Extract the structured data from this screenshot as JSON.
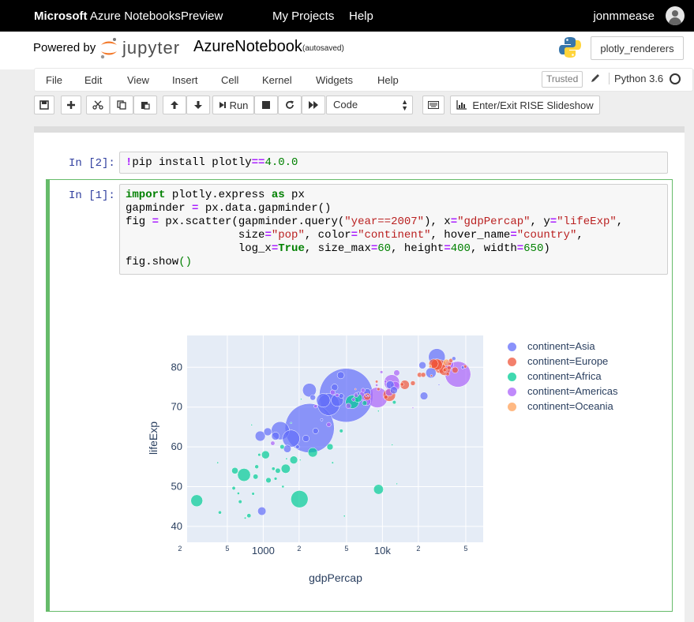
{
  "azure_bar": {
    "brand_bold": "Microsoft",
    "brand_rest": " Azure Notebooks",
    "preview": "Preview",
    "my_projects": "My Projects",
    "help": "Help",
    "user": "jonmmease"
  },
  "header": {
    "powered_by": "Powered by",
    "jupyter_word": "jupyter",
    "notebook_name": "AzureNotebook",
    "save_status": "(autosaved)",
    "kernel_button": "plotly_renderers"
  },
  "menubar": {
    "items": [
      "File",
      "Edit",
      "View",
      "Insert",
      "Cell",
      "Kernel",
      "Widgets",
      "Help"
    ],
    "trusted": "Trusted",
    "kernel": "Python 3.6"
  },
  "toolbar": {
    "run": "Run",
    "cell_type": "Code",
    "rise": "Enter/Exit RISE Slideshow"
  },
  "cells": [
    {
      "prompt": "In [2]:",
      "code_parts": [
        [
          "bang",
          "!"
        ],
        [
          "plain",
          "pip install plotly"
        ],
        [
          "op",
          "=="
        ],
        [
          "num",
          "4.0.0"
        ]
      ]
    },
    {
      "prompt": "In [1]:",
      "lines": [
        [
          [
            "kw",
            "import"
          ],
          [
            "plain",
            " plotly.express "
          ],
          [
            "kw",
            "as"
          ],
          [
            "plain",
            " px"
          ]
        ],
        [
          [
            "plain",
            "gapminder "
          ],
          [
            "op",
            "="
          ],
          [
            "plain",
            " px.data.gapminder()"
          ]
        ],
        [
          [
            "plain",
            "fig "
          ],
          [
            "op",
            "="
          ],
          [
            "plain",
            " px.scatter(gapminder.query("
          ],
          [
            "str",
            "\"year==2007\""
          ],
          [
            "plain",
            "), x"
          ],
          [
            "op",
            "="
          ],
          [
            "str",
            "\"gdpPercap\""
          ],
          [
            "plain",
            ", y"
          ],
          [
            "op",
            "="
          ],
          [
            "str",
            "\"lifeExp\""
          ],
          [
            "plain",
            ","
          ]
        ],
        [
          [
            "plain",
            "                 size"
          ],
          [
            "op",
            "="
          ],
          [
            "str",
            "\"pop\""
          ],
          [
            "plain",
            ", color"
          ],
          [
            "op",
            "="
          ],
          [
            "str",
            "\"continent\""
          ],
          [
            "plain",
            ", hover_name"
          ],
          [
            "op",
            "="
          ],
          [
            "str",
            "\"country\""
          ],
          [
            "plain",
            ","
          ]
        ],
        [
          [
            "plain",
            "                 log_x"
          ],
          [
            "op",
            "="
          ],
          [
            "kw",
            "True"
          ],
          [
            "plain",
            ", size_max"
          ],
          [
            "op",
            "="
          ],
          [
            "num",
            "60"
          ],
          [
            "plain",
            ", height"
          ],
          [
            "op",
            "="
          ],
          [
            "num",
            "400"
          ],
          [
            "plain",
            ", width"
          ],
          [
            "op",
            "="
          ],
          [
            "num",
            "650"
          ],
          [
            "plain",
            ")"
          ]
        ],
        [
          [
            "plain",
            "fig.show"
          ],
          [
            "num",
            "()"
          ]
        ]
      ]
    }
  ],
  "chart_data": {
    "type": "scatter",
    "xlabel": "gdpPercap",
    "ylabel": "lifeExp",
    "x_scale": "log",
    "xlim": [
      230,
      70000
    ],
    "ylim": [
      36,
      88
    ],
    "x_ticks": [
      {
        "value": 200,
        "label": "2"
      },
      {
        "value": 500,
        "label": "5"
      },
      {
        "value": 1000,
        "label": "1000"
      },
      {
        "value": 2000,
        "label": "2"
      },
      {
        "value": 5000,
        "label": "5"
      },
      {
        "value": 10000,
        "label": "10k"
      },
      {
        "value": 20000,
        "label": "2"
      },
      {
        "value": 50000,
        "label": "5"
      }
    ],
    "y_ticks": [
      40,
      50,
      60,
      70,
      80
    ],
    "grid": true,
    "legend_position": "right",
    "series": [
      {
        "name": "continent=Asia",
        "color": "#636efa",
        "points": [
          [
            4959,
            72.96,
            1318683096
          ],
          [
            2452,
            64.7,
            1110396331
          ],
          [
            3541,
            70.65,
            223547000
          ],
          [
            1391,
            64.06,
            150448339
          ],
          [
            28604,
            82.6,
            127467972
          ],
          [
            1713,
            62.07,
            135031164
          ],
          [
            3190,
            71.69,
            85262356
          ],
          [
            2442,
            74.25,
            85262356
          ],
          [
            1091,
            63.79,
            28901790
          ],
          [
            974,
            43.83,
            31889923
          ],
          [
            7458,
            73.75,
            22276056
          ],
          [
            4471,
            78.0,
            23174294
          ],
          [
            12452,
            74.24,
            24821286
          ],
          [
            21655,
            80.5,
            23301725
          ],
          [
            47143,
            79.97,
            4553009
          ],
          [
            39725,
            82.2,
            6980412
          ],
          [
            944,
            62.7,
            47761980
          ],
          [
            1593,
            59.5,
            26000000
          ],
          [
            2282,
            62.1,
            19951656
          ],
          [
            3970,
            74.95,
            20378239
          ],
          [
            4185,
            71.7,
            69453570
          ],
          [
            22316,
            72.8,
            27601038
          ],
          [
            11606,
            75.6,
            28901790
          ],
          [
            2605,
            72.4,
            14131858
          ],
          [
            1940,
            60.0,
            6500000
          ],
          [
            3095,
            66.8,
            2874127
          ],
          [
            6290,
            73.4,
            4100000
          ],
          [
            4519,
            72.8,
            10300000
          ],
          [
            25523,
            78.6,
            49044790
          ],
          [
            29796,
            75.6,
            708573
          ],
          [
            1268,
            62.7,
            29000000
          ],
          [
            2749,
            64.0,
            15000000
          ]
        ]
      },
      {
        "name": "continent=Europe",
        "color": "#ef553b",
        "points": [
          [
            30470,
            80.2,
            82400996
          ],
          [
            28569,
            80.7,
            58147733
          ],
          [
            33203,
            79.4,
            60776238
          ],
          [
            28570,
            80.5,
            61083916
          ],
          [
            26865,
            80.9,
            40448191
          ],
          [
            15390,
            75.6,
            38518241
          ],
          [
            7457,
            72.6,
            22276056
          ],
          [
            11416,
            73.0,
            71158647
          ],
          [
            36180,
            79.8,
            8199783
          ],
          [
            33692,
            79.4,
            10392226
          ],
          [
            40676,
            79.3,
            16570613
          ],
          [
            22000,
            78.1,
            10642836
          ],
          [
            18009,
            76.0,
            10228744
          ],
          [
            20510,
            78.1,
            10706290
          ],
          [
            37506,
            81.7,
            7554661
          ],
          [
            10680,
            72.5,
            7322858
          ],
          [
            9253,
            74.5,
            4552198
          ],
          [
            25768,
            77.9,
            2009245
          ],
          [
            14619,
            75.7,
            5447502
          ],
          [
            36319,
            80.9,
            9031088
          ],
          [
            35278,
            78.3,
            5468120
          ],
          [
            33207,
            79.3,
            5238460
          ],
          [
            49357,
            80.2,
            4627926
          ],
          [
            36811,
            80.9,
            4109086
          ],
          [
            8948,
            76.4,
            3600523
          ],
          [
            5937,
            74.5,
            1300000
          ]
        ]
      },
      {
        "name": "continent=Africa",
        "color": "#00cc96",
        "points": [
          [
            2014,
            46.86,
            135031164
          ],
          [
            690,
            52.95,
            76511887
          ],
          [
            1803,
            56.7,
            28000000
          ],
          [
            5581,
            71.3,
            80264543
          ],
          [
            9270,
            49.3,
            43997828
          ],
          [
            6223,
            72.3,
            33333216
          ],
          [
            2603,
            58.6,
            40448191
          ],
          [
            277,
            46.46,
            64606759
          ],
          [
            1046,
            58.0,
            29170398
          ],
          [
            1544,
            54.5,
            38139640
          ],
          [
            3632,
            60.0,
            18000000
          ],
          [
            1327,
            54.0,
            12000000
          ],
          [
            7093,
            71.0,
            10276158
          ],
          [
            4513,
            64.0,
            6036914
          ],
          [
            9253,
            69.0,
            1300000
          ],
          [
            12570,
            71.2,
            6036914
          ],
          [
            863,
            52.5,
            12000000
          ],
          [
            579,
            54.0,
            19000000
          ],
          [
            1107,
            51.6,
            13000000
          ],
          [
            759,
            42.7,
            8000000
          ],
          [
            1441,
            60.0,
            9000000
          ],
          [
            882,
            55.0,
            7000000
          ],
          [
            641,
            46.2,
            6000000
          ],
          [
            433,
            43.5,
            5000000
          ],
          [
            926,
            58.0,
            4000000
          ],
          [
            1463,
            50.0,
            3000000
          ],
          [
            706,
            42.1,
            2000000
          ],
          [
            13206,
            50.7,
            1000000
          ],
          [
            4797,
            42.6,
            1500000
          ],
          [
            1569,
            57.0,
            1600000
          ],
          [
            619,
            48.3,
            3100000
          ],
          [
            823,
            48.2,
            3900000
          ],
          [
            1217,
            54.5,
            5300000
          ],
          [
            415,
            56.0,
            1500000
          ],
          [
            1712,
            66.0,
            700000
          ],
          [
            2082,
            72.0,
            500000
          ],
          [
            1270,
            52.0,
            4400000
          ],
          [
            566,
            49.6,
            5600000
          ],
          [
            12057,
            60.5,
            800000
          ],
          [
            3820,
            56.0,
            2000000
          ],
          [
            2042,
            56.7,
            1000000
          ],
          [
            800,
            65.5,
            600000
          ]
        ]
      },
      {
        "name": "continent=Americas",
        "color": "#ab63fa",
        "points": [
          [
            42952,
            78.24,
            301139947
          ],
          [
            9066,
            72.4,
            190010647
          ],
          [
            11977,
            76.2,
            108700891
          ],
          [
            7007,
            72.9,
            44227550
          ],
          [
            12779,
            75.3,
            40301927
          ],
          [
            7409,
            71.4,
            28674757
          ],
          [
            36319,
            80.65,
            33390141
          ],
          [
            11416,
            73.7,
            26084662
          ],
          [
            13172,
            78.6,
            16284741
          ],
          [
            5186,
            70.3,
            12572928
          ],
          [
            6873,
            74.2,
            8000000
          ],
          [
            3822,
            73.7,
            11416987
          ],
          [
            6025,
            73.0,
            9319622
          ],
          [
            1202,
            60.9,
            8502814
          ],
          [
            4172,
            73.0,
            6000000
          ],
          [
            5728,
            71.9,
            6000000
          ],
          [
            9809,
            78.8,
            4133884
          ],
          [
            10611,
            76.4,
            3447496
          ],
          [
            18009,
            69.8,
            1000000
          ],
          [
            8948,
            75.5,
            3242173
          ],
          [
            7321,
            72.9,
            2780132
          ],
          [
            3548,
            65.6,
            9119152
          ],
          [
            2749,
            70.2,
            5675356
          ],
          [
            7670,
            72.8,
            1000000
          ]
        ]
      },
      {
        "name": "continent=Oceania",
        "color": "#ffa15a",
        "points": [
          [
            34435,
            81.2,
            20434176
          ],
          [
            25185,
            80.2,
            4115771
          ]
        ]
      }
    ]
  }
}
